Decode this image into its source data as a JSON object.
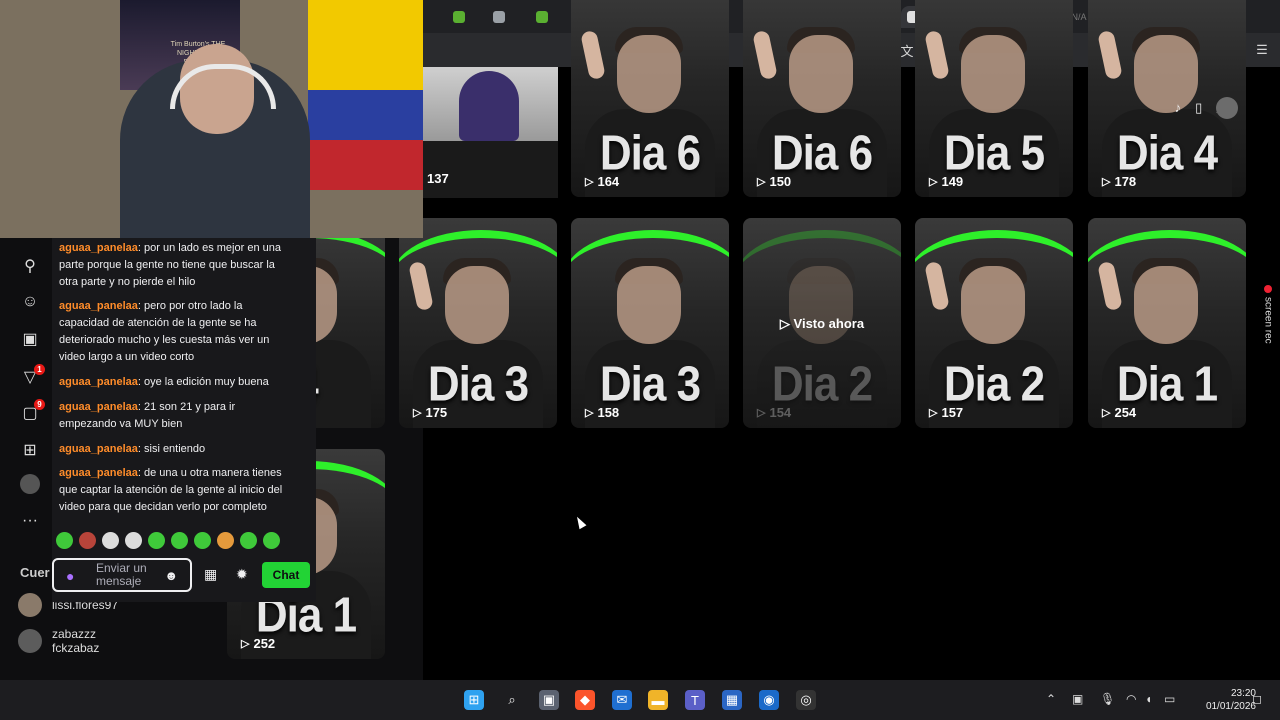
{
  "browser": {
    "tabs": [
      {
        "icon": "shopify-icon",
        "color": "#5ab031"
      },
      {
        "icon": "site-icon",
        "color": "#9aa0a6"
      },
      {
        "icon": "shopify-icon",
        "color": "#5ab031"
      },
      {
        "icon": "site-icon",
        "color": "#9aa0a6"
      },
      {
        "icon": "shopify-icon",
        "color": "#5ab031"
      },
      {
        "icon": "site-icon",
        "color": "#9aa0a6"
      },
      {
        "icon": "site-icon",
        "color": "#9aa0a6"
      },
      {
        "icon": "app-icon",
        "color": "#3a5bd9"
      },
      {
        "icon": "site-icon",
        "color": "#9aa0a6"
      },
      {
        "icon": "paypal-icon",
        "color": "#1d5fd1"
      },
      {
        "icon": "tiktok-icon",
        "color": "#111111"
      },
      {
        "icon": "active-tab-icon",
        "color": "#e0e0e0"
      },
      {
        "icon": "youtube-icon",
        "color": "#e62117"
      },
      {
        "icon": "gmail-icon",
        "color": "#d93025"
      },
      {
        "icon": "app-icon",
        "color": "#c47a2c"
      }
    ],
    "stats": "ITS N/A   GPU 36 %   CPU 23 %   LAT N/A"
  },
  "grid": {
    "first_tile_views": "137",
    "rows": [
      [
        {
          "title": "Dia 6",
          "views": "164",
          "arc": false,
          "finger": true
        },
        {
          "title": "Dia 6",
          "views": "150",
          "arc": false,
          "finger": true
        },
        {
          "title": "Dia 5",
          "views": "149",
          "arc": false,
          "finger": true
        },
        {
          "title": "Dia 4",
          "views": "178",
          "arc": false,
          "finger": true
        }
      ],
      [
        {
          "title": "Dia 3",
          "views": "175",
          "arc": true,
          "finger": true
        },
        {
          "title": "Dia 3",
          "views": "158",
          "arc": true,
          "finger": false
        },
        {
          "title": "Dia 2",
          "views": "154",
          "arc": true,
          "finger": false,
          "watched": true
        },
        {
          "title": "Dia 2",
          "views": "157",
          "arc": true,
          "finger": true
        },
        {
          "title": "Dia 1",
          "views": "254",
          "arc": true,
          "finger": true
        }
      ]
    ],
    "partial_tiles": [
      {
        "title": "4",
        "views": ""
      },
      {
        "title": "Dia 1",
        "views": "252"
      }
    ],
    "watched_label": "Visto ahora",
    "screen_rec_label": "screen rec"
  },
  "webcam": {
    "poster_text": "Tim Burton's THE NIGHTMARE BEFORE CHRISTMAS"
  },
  "sidebar": {
    "badges": [
      "1",
      "9"
    ],
    "cue_label": "Cuer",
    "viewers": [
      {
        "name": "lissi.flores97"
      },
      {
        "name": "zabazzz",
        "sub": "fckzabaz"
      }
    ]
  },
  "chat": {
    "messages": [
      {
        "user": "aguaa_panelaa",
        "text": "por un lado es mejor en una parte porque la gente no tiene que buscar la otra parte y no pierde el hilo"
      },
      {
        "user": "aguaa_panelaa",
        "text": "pero por otro lado la capacidad de atención de la gente se ha deteriorado mucho y les cuesta más ver un video largo a un video corto"
      },
      {
        "user": "aguaa_panelaa",
        "text": "oye la edición muy buena"
      },
      {
        "user": "aguaa_panelaa",
        "text": "21 son 21 y para ir empezando va MUY bien"
      },
      {
        "user": "aguaa_panelaa",
        "text": "sisi entiendo"
      },
      {
        "user": "aguaa_panelaa",
        "text": "de una u otra manera tienes que captar la atención de la gente al inicio del video para que decidan verlo por completo"
      }
    ],
    "input_placeholder": "Enviar un mensaje",
    "send_label": "Chat",
    "emote_count": 10
  },
  "taskbar": {
    "time": "23:20",
    "date": "01/01/2026"
  }
}
